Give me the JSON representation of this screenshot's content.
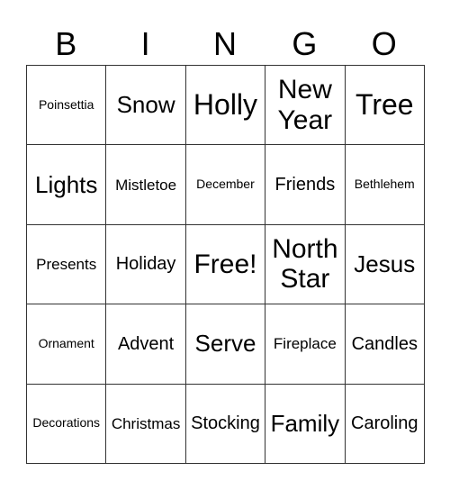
{
  "header": [
    "B",
    "I",
    "N",
    "G",
    "O"
  ],
  "rows": [
    [
      {
        "text": "Poinsettia",
        "size": "s1"
      },
      {
        "text": "Snow",
        "size": "s4"
      },
      {
        "text": "Holly",
        "size": "s6"
      },
      {
        "text": "New Year",
        "size": "s5"
      },
      {
        "text": "Tree",
        "size": "s6"
      }
    ],
    [
      {
        "text": "Lights",
        "size": "s4"
      },
      {
        "text": "Mistletoe",
        "size": "s2"
      },
      {
        "text": "December",
        "size": "s1"
      },
      {
        "text": "Friends",
        "size": "s3"
      },
      {
        "text": "Bethlehem",
        "size": "s1"
      }
    ],
    [
      {
        "text": "Presents",
        "size": "s2"
      },
      {
        "text": "Holiday",
        "size": "s3"
      },
      {
        "text": "Free!",
        "size": "s5"
      },
      {
        "text": "North Star",
        "size": "s5"
      },
      {
        "text": "Jesus",
        "size": "s4"
      }
    ],
    [
      {
        "text": "Ornament",
        "size": "s1"
      },
      {
        "text": "Advent",
        "size": "s3"
      },
      {
        "text": "Serve",
        "size": "s4"
      },
      {
        "text": "Fireplace",
        "size": "s2"
      },
      {
        "text": "Candles",
        "size": "s3"
      }
    ],
    [
      {
        "text": "Decorations",
        "size": "s1"
      },
      {
        "text": "Christmas",
        "size": "s2"
      },
      {
        "text": "Stocking",
        "size": "s3"
      },
      {
        "text": "Family",
        "size": "s4"
      },
      {
        "text": "Caroling",
        "size": "s3"
      }
    ]
  ]
}
